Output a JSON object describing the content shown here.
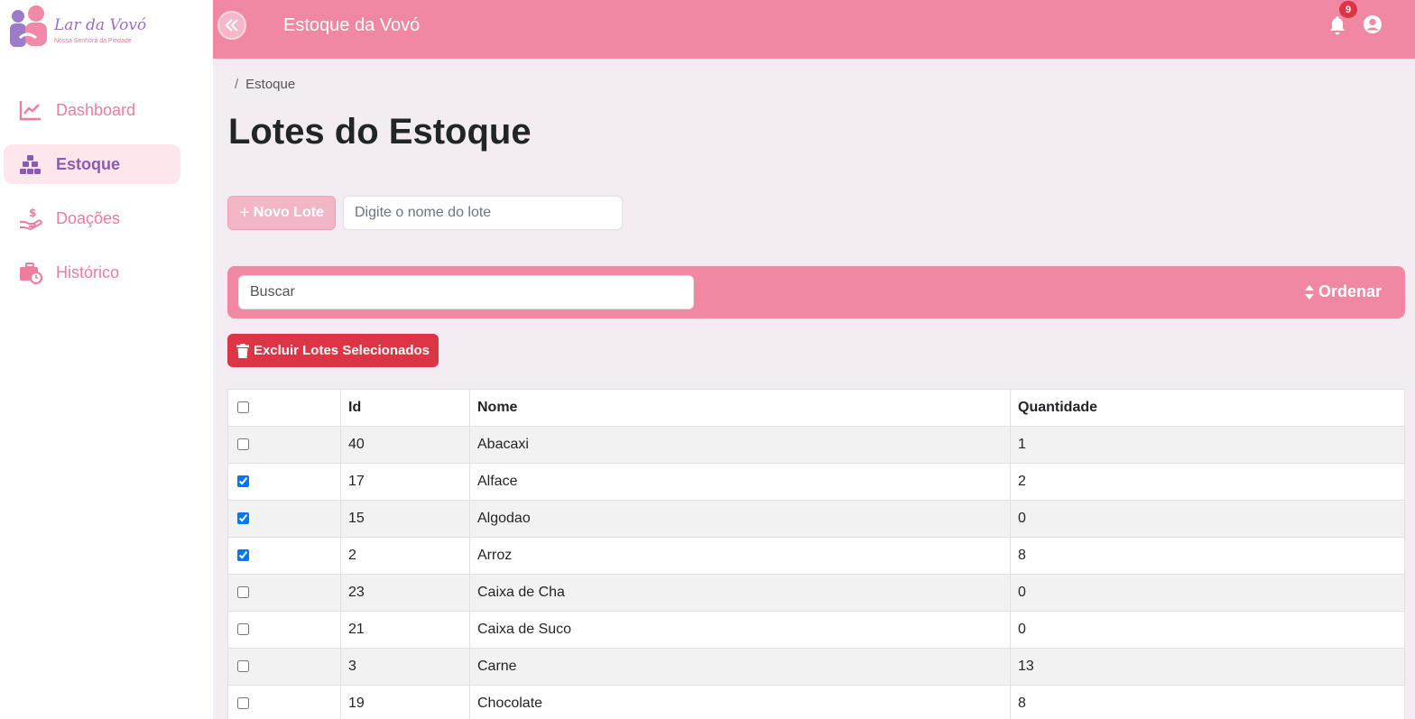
{
  "logo": {
    "name": "Lar da Vovó",
    "subtitle": "Nossa Senhora da Piedade"
  },
  "sidebar": {
    "items": [
      {
        "label": "Dashboard",
        "icon": "chart-line-icon",
        "active": false
      },
      {
        "label": "Estoque",
        "icon": "boxes-icon",
        "active": true
      },
      {
        "label": "Doações",
        "icon": "hand-holding-dollar-icon",
        "active": false
      },
      {
        "label": "Histórico",
        "icon": "briefcase-clock-icon",
        "active": false
      }
    ]
  },
  "header": {
    "title": "Estoque da Vovó",
    "notification_count": "9"
  },
  "breadcrumb": {
    "separator": "/",
    "current": "Estoque"
  },
  "page": {
    "title": "Lotes do Estoque"
  },
  "new_lot": {
    "button_label": "Novo Lote",
    "input_placeholder": "Digite o nome do lote"
  },
  "filter": {
    "search_placeholder": "Buscar",
    "sort_label": "Ordenar"
  },
  "actions": {
    "delete_label": "Excluir Lotes Selecionados"
  },
  "table": {
    "headers": {
      "id": "Id",
      "nome": "Nome",
      "quantidade": "Quantidade"
    },
    "rows": [
      {
        "checked": false,
        "id": "40",
        "nome": "Abacaxi",
        "quantidade": "1"
      },
      {
        "checked": true,
        "id": "17",
        "nome": "Alface",
        "quantidade": "2"
      },
      {
        "checked": true,
        "id": "15",
        "nome": "Algodao",
        "quantidade": "0"
      },
      {
        "checked": true,
        "id": "2",
        "nome": "Arroz",
        "quantidade": "8"
      },
      {
        "checked": false,
        "id": "23",
        "nome": "Caixa de Cha",
        "quantidade": "0"
      },
      {
        "checked": false,
        "id": "21",
        "nome": "Caixa de Suco",
        "quantidade": "0"
      },
      {
        "checked": false,
        "id": "3",
        "nome": "Carne",
        "quantidade": "13"
      },
      {
        "checked": false,
        "id": "19",
        "nome": "Chocolate",
        "quantidade": "8"
      }
    ]
  },
  "colors": {
    "primary_pink": "#f088a2",
    "sidebar_text": "#ee7c9e",
    "active_text": "#8a5bb5",
    "danger": "#dc3545"
  }
}
